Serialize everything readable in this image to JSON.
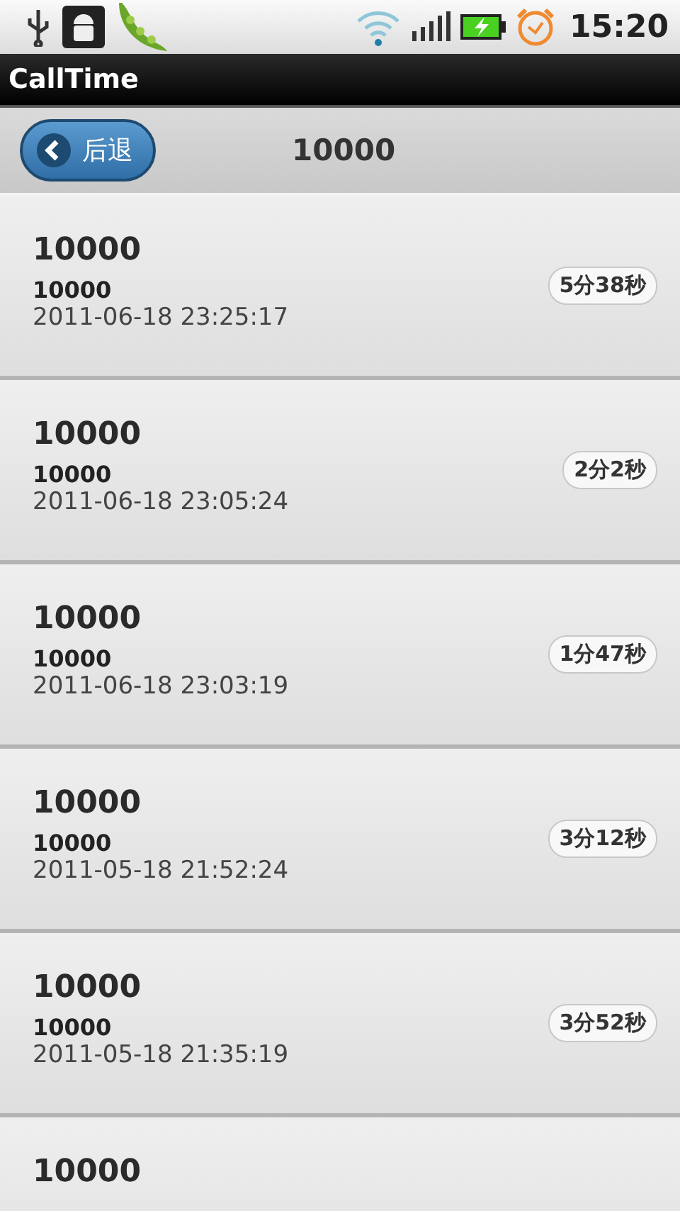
{
  "status_bar": {
    "time": "15:20"
  },
  "app_title": "CallTime",
  "toolbar": {
    "back_button": "后退",
    "title": "10000"
  },
  "calls": [
    {
      "name": "10000",
      "number": "10000",
      "datetime": "2011-06-18 23:25:17",
      "duration": "5分38秒"
    },
    {
      "name": "10000",
      "number": "10000",
      "datetime": "2011-06-18 23:05:24",
      "duration": "2分2秒"
    },
    {
      "name": "10000",
      "number": "10000",
      "datetime": "2011-06-18 23:03:19",
      "duration": "1分47秒"
    },
    {
      "name": "10000",
      "number": "10000",
      "datetime": "2011-05-18 21:52:24",
      "duration": "3分12秒"
    },
    {
      "name": "10000",
      "number": "10000",
      "datetime": "2011-05-18 21:35:19",
      "duration": "3分52秒"
    },
    {
      "name": "10000"
    }
  ]
}
